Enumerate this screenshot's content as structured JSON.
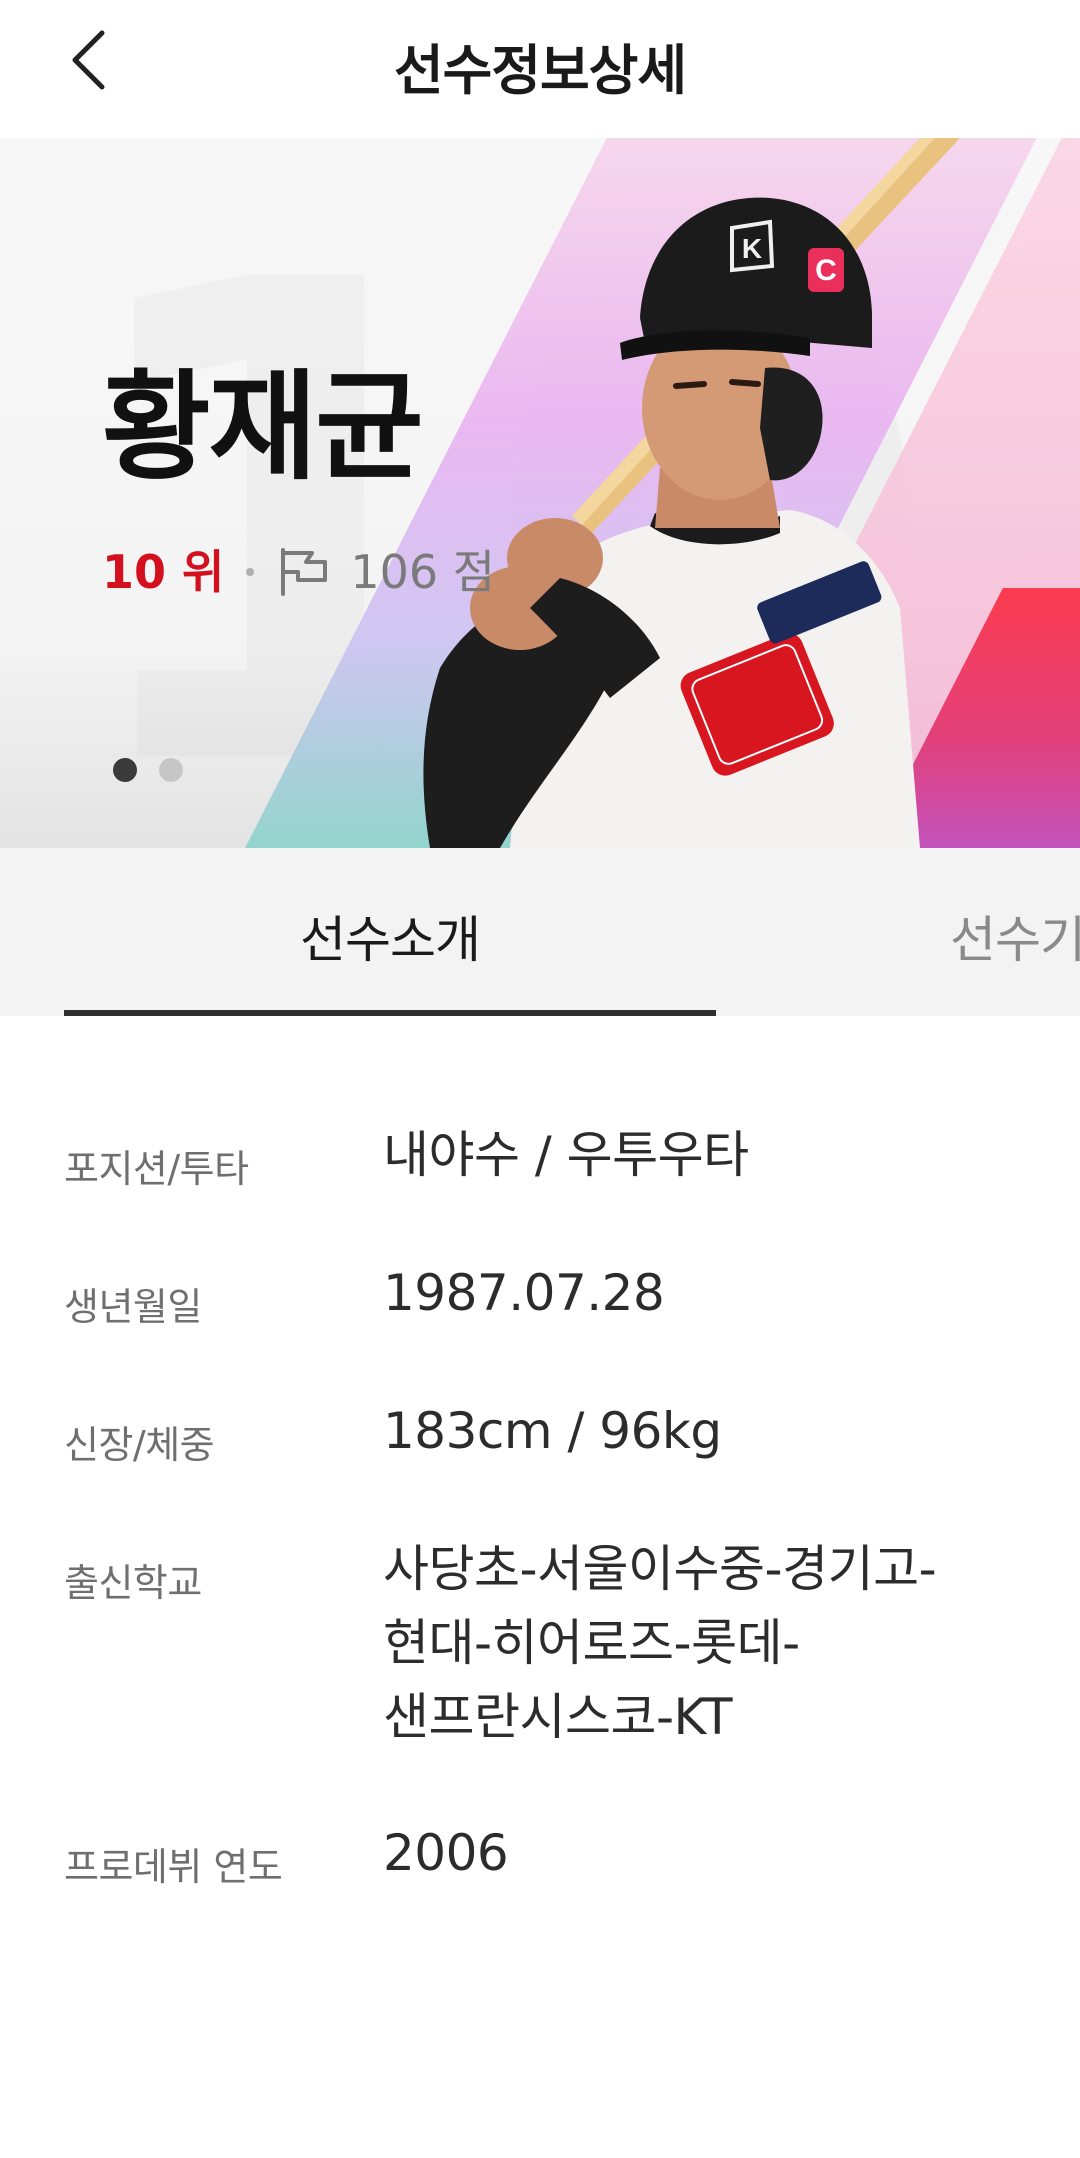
{
  "header": {
    "title": "선수정보상세"
  },
  "hero": {
    "background_number": "10",
    "player_name": "황재균",
    "rank": "10 위",
    "points": "106 점",
    "slides_total": 2,
    "slide_active": 1
  },
  "tabs": [
    {
      "label": "선수소개",
      "active": true
    },
    {
      "label": "선수기",
      "active": false
    }
  ],
  "info": [
    {
      "label": "포지션/투타",
      "value": "내야수 / 우투우타"
    },
    {
      "label": "생년월일",
      "value": "1987.07.28"
    },
    {
      "label": "신장/체중",
      "value": "183cm / 96kg"
    },
    {
      "label": "출신학교",
      "value": "사당초-서울이수중-경기고-현대-히어로즈-롯데-샌프란시스코-KT"
    },
    {
      "label": "프로데뷔 연도",
      "value": "2006"
    }
  ],
  "icons": {
    "back": "chevron-left-icon",
    "points": "flag-icon"
  },
  "colors": {
    "rank_red": "#d4101f",
    "team_red": "#fb3b4f",
    "text_dark": "#1a1a1a",
    "text_muted": "#6f6f6f"
  }
}
